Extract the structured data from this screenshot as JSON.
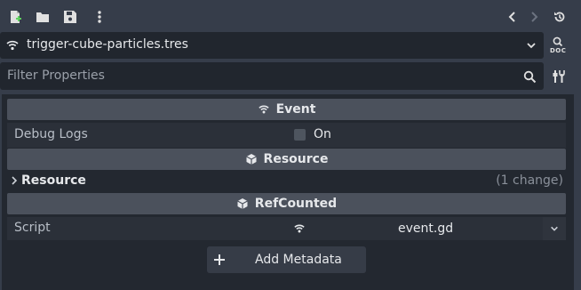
{
  "toolbar": {
    "icons": [
      "new-resource-icon",
      "open-folder-icon",
      "save-icon",
      "more-options-icon",
      "history-back-icon",
      "history-forward-icon",
      "history-list-icon"
    ]
  },
  "resource": {
    "name": "trigger-cube-particles.tres",
    "doc_label": "DOC"
  },
  "filter": {
    "placeholder": "Filter Properties"
  },
  "sections": {
    "event": "Event",
    "resource": "Resource",
    "refcounted": "RefCounted"
  },
  "properties": {
    "debug_logs": {
      "label": "Debug Logs",
      "value": "On",
      "checked": false
    },
    "resource_group": {
      "label": "Resource",
      "changes": "(1 change)"
    },
    "script": {
      "label": "Script",
      "value": "event.gd"
    }
  },
  "add_metadata": {
    "label": "Add Metadata"
  },
  "colors": {
    "background": "#363d4a",
    "field": "#21262e",
    "panel": "#232830",
    "section_header": "#4b515c",
    "text": "#e6e8eb",
    "muted": "#8a909a"
  }
}
